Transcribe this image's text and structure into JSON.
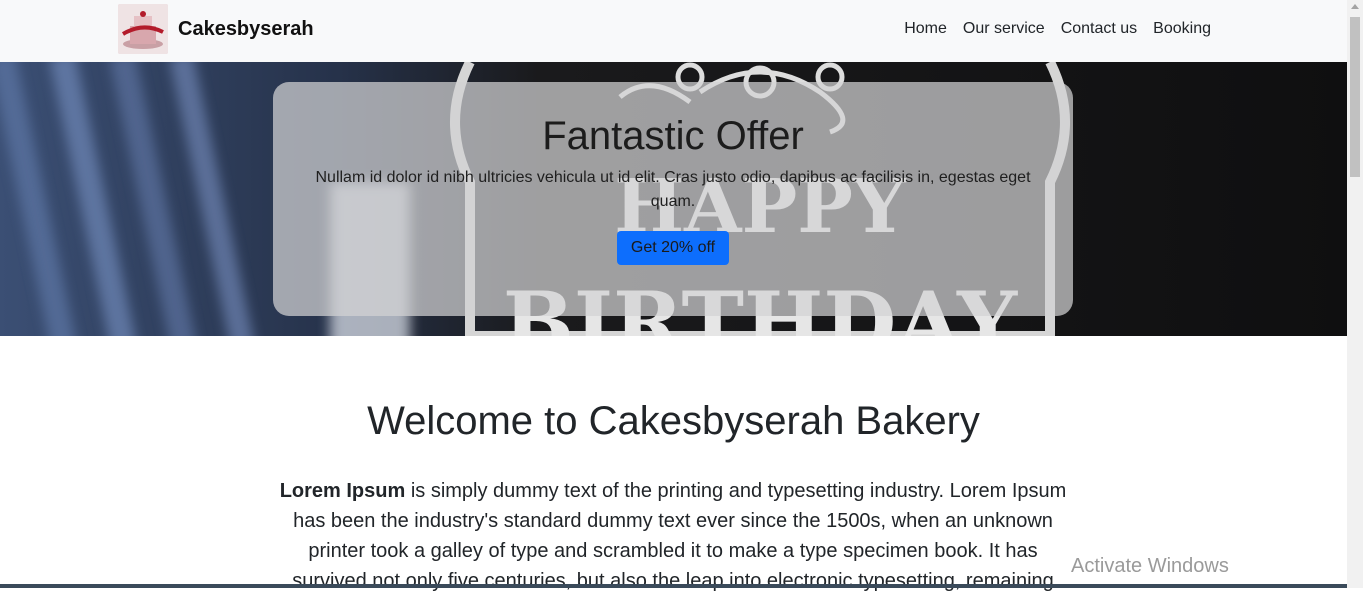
{
  "navbar": {
    "brand_name": "Cakesbyserah",
    "links": [
      "Home",
      "Our service",
      "Contact us",
      "Booking"
    ]
  },
  "hero": {
    "title": "Fantastic Offer",
    "text": "Nullam id dolor id nibh ultricies vehicula ut id elit. Cras justo odio, dapibus ac facilisis in, egestas eget quam.",
    "button_label": "Get 20% off",
    "background_sign_text": "HAPPY BIRTHDAY"
  },
  "main": {
    "title": "Welcome to Cakesbyserah Bakery",
    "intro_bold": "Lorem Ipsum",
    "intro_text": " is simply dummy text of the printing and typesetting industry. Lorem Ipsum has been the industry's standard dummy text ever since the 1500s, when an unknown printer took a galley of type and scrambled it to make a type specimen book. It has survived not only five centuries, but also the leap into electronic typesetting, remaining"
  },
  "watermark": "Activate Windows",
  "colors": {
    "navbar_bg": "#f8f9fa",
    "button_primary": "#0d6efd",
    "hero_card": "#d2d2d4"
  }
}
